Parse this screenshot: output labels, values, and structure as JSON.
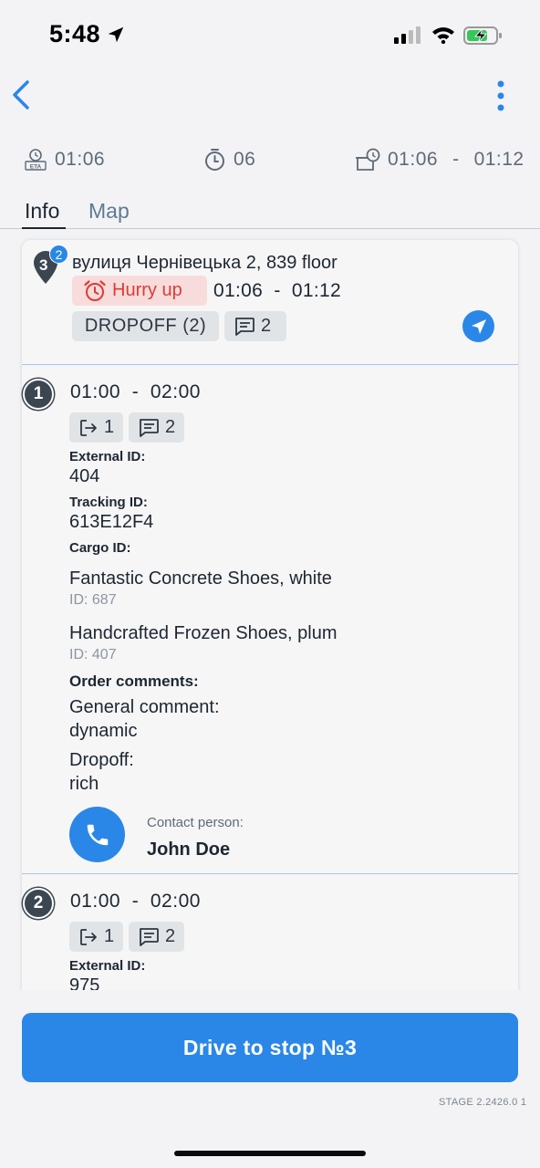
{
  "status_bar": {
    "time": "5:48"
  },
  "summary": {
    "eta": "01:06",
    "duration": "06",
    "window_start": "01:06",
    "window_sep": "-",
    "window_end": "01:12"
  },
  "tabs": [
    {
      "label": "Info",
      "active": true
    },
    {
      "label": "Map",
      "active": false
    }
  ],
  "stop": {
    "number": "3",
    "badge_count": "2",
    "address": "вулиця Чернівецька 2, 839 floor",
    "hurry_label": "Hurry up",
    "time_window": "01:06  -  01:12",
    "type_chip": "DROPOFF (2)",
    "comments_count": "2"
  },
  "orders": [
    {
      "index": "1",
      "time_window": "01:00  -  02:00",
      "exits_count": "1",
      "comments_count": "2",
      "external_id_label": "External ID:",
      "external_id": "404",
      "tracking_id_label": "Tracking ID:",
      "tracking_id": "613E12F4",
      "cargo_id_label": "Cargo ID:",
      "cargo": [
        {
          "name": "Fantastic Concrete Shoes, white",
          "id": "ID: 687"
        },
        {
          "name": "Handcrafted Frozen Shoes, plum",
          "id": "ID: 407"
        }
      ],
      "order_comments_label": "Order comments:",
      "general_comment_label": "General comment:",
      "general_comment": "dynamic",
      "dropoff_label": "Dropoff:",
      "dropoff_comment": "rich",
      "contact_label": "Contact person:",
      "contact_name": "John Doe"
    },
    {
      "index": "2",
      "time_window": "01:00  -  02:00",
      "exits_count": "1",
      "comments_count": "2",
      "external_id_label": "External ID:",
      "external_id": "975"
    }
  ],
  "drive_button": "Drive to stop №3",
  "stage_label": "STAGE 2.2426.0 1",
  "colors": {
    "accent": "#2a87e8",
    "hurry_bg": "#f8dcdc",
    "hurry_text": "#e03a36",
    "chip_bg": "#e1e4e7"
  }
}
